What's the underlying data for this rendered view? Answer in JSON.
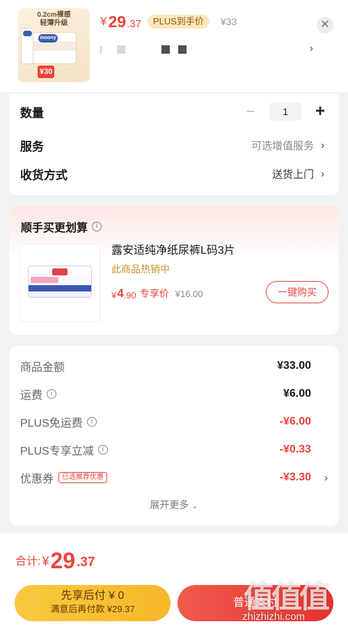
{
  "product": {
    "thumb_caption_line1": "0.2cm裸感",
    "thumb_caption_line2": "轻薄升级",
    "thumb_brand": "moony",
    "thumb_price": "¥30",
    "price_symbol": "¥",
    "price_int": "29",
    "price_dec": ".37",
    "plus_tag": "PLUS到手价",
    "original_price": "¥33",
    "close_icon": "✕",
    "variant_arrow": "›"
  },
  "options": {
    "quantity_label": "数量",
    "quantity_value": "1",
    "minus": "−",
    "plus": "+",
    "service_label": "服务",
    "service_value": "可选增值服务",
    "delivery_label": "收货方式",
    "delivery_value": "送货上门",
    "chevron": "›"
  },
  "addon": {
    "title": "顺手买更划算",
    "info_icon": "i",
    "name": "露安适纯净纸尿裤L码3片",
    "hot": "此商品热销中",
    "price_symbol": "¥",
    "price_int": "4",
    "price_dec": ".90",
    "price_label": "专享价",
    "original_price": "¥16.00",
    "buy_button": "一键购买"
  },
  "summary": {
    "rows": [
      {
        "label": "商品金额",
        "value": "¥33.00"
      },
      {
        "label": "运费",
        "value": "¥6.00"
      },
      {
        "label": "PLUS免运费",
        "value": "-¥6.00"
      },
      {
        "label": "PLUS专享立减",
        "value": "-¥0.33"
      },
      {
        "label": "优惠券",
        "tag": "已选推荐优惠",
        "value": "-¥3.30"
      }
    ],
    "info_icon": "i",
    "chevron": "›",
    "expand_label": "展开更多",
    "expand_icon": "⌄"
  },
  "bottom": {
    "total_label": "合计:",
    "total_symbol": "¥",
    "total_int": "29",
    "total_dec": ".37",
    "pay_later_title": "先享后付 ¥ 0",
    "pay_later_sub": "满意后再付款 ¥29.37",
    "pay_normal": "普通支付"
  },
  "watermark": {
    "mark": "值值值",
    "url": "zhizhizhi.com"
  },
  "colors": {
    "accent_red": "#e8453c",
    "plus_gold": "#fde7bd",
    "pay_later_yellow": "#f9c83f"
  }
}
